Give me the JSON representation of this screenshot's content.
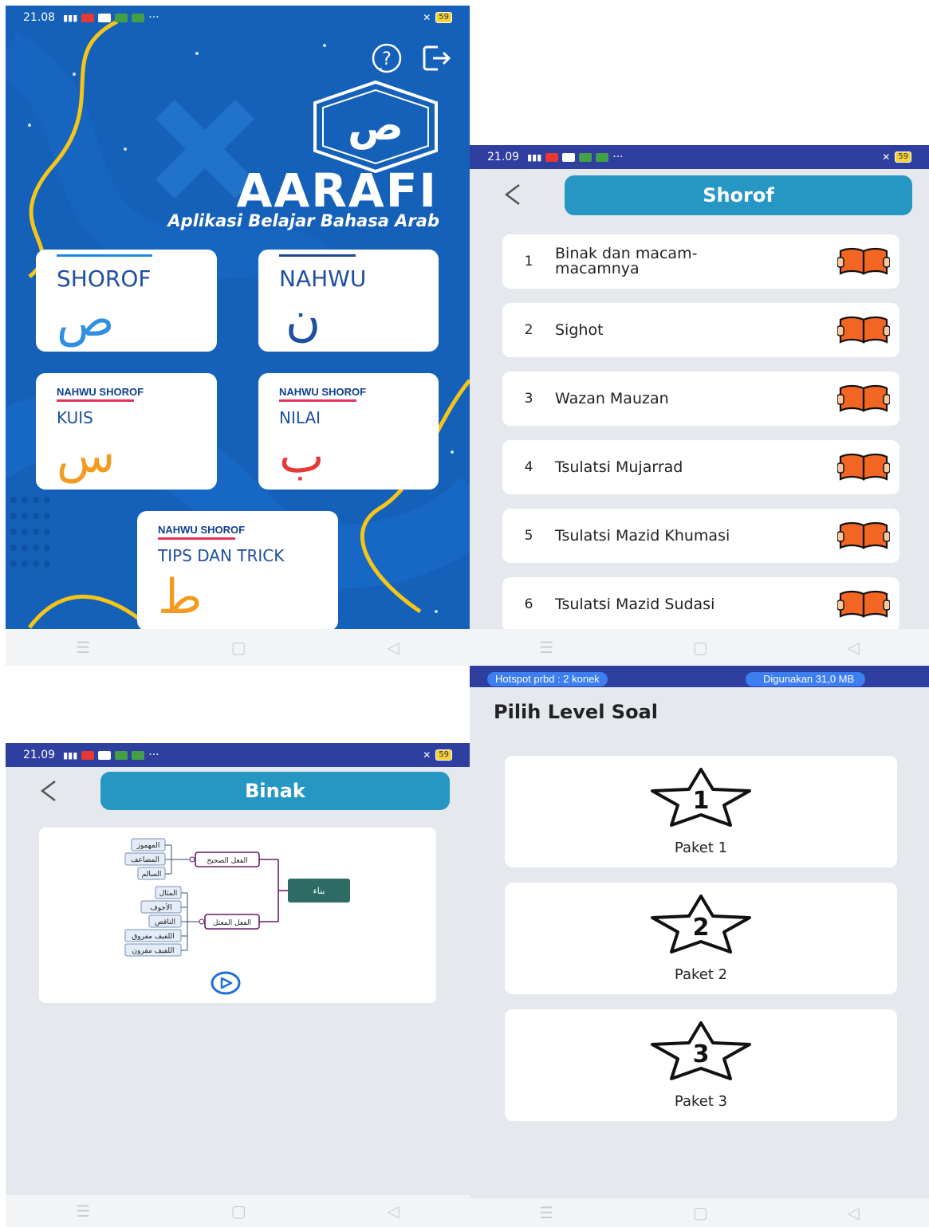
{
  "home": {
    "status_time": "21.08",
    "battery": "59",
    "brand": "AARAFI",
    "tagline": "Aplikasi Belajar Bahasa Arab",
    "help_icon": "help-circle-icon",
    "logout_icon": "logout-icon",
    "cards": {
      "shorof": {
        "title": "SHOROF",
        "letter": "ص"
      },
      "nahwu": {
        "title": "NAHWU",
        "letter": "ن"
      },
      "kuis": {
        "subtitle": "NAHWU SHOROF",
        "title": "KUIS",
        "letter": "س"
      },
      "nilai": {
        "subtitle": "NAHWU SHOROF",
        "title": "NILAI",
        "letter": "ب"
      },
      "tips": {
        "subtitle": "NAHWU SHOROF",
        "title": "TIPS DAN TRICK",
        "letter": "ط"
      }
    },
    "colors": {
      "background": "#1560b8",
      "accent_yellow": "#f5c518",
      "title_blue": "#1f4fa0",
      "underline_red": "#e2325b"
    }
  },
  "shorof": {
    "status_time": "21.09",
    "battery": "59",
    "header": "Shorof",
    "back_icon": "chevron-left-icon",
    "lessons": [
      {
        "num": "1",
        "label": "Binak dan macam-macamnya",
        "icon": "book-icon"
      },
      {
        "num": "2",
        "label": "Sighot",
        "icon": "book-icon"
      },
      {
        "num": "3",
        "label": "Wazan Mauzan",
        "icon": "book-icon"
      },
      {
        "num": "4",
        "label": "Tsulatsi Mujarrad",
        "icon": "book-icon"
      },
      {
        "num": "5",
        "label": "Tsulatsi Mazid Khumasi",
        "icon": "book-icon"
      },
      {
        "num": "6",
        "label": "Tsulatsi Mazid Sudasi",
        "icon": "book-icon"
      }
    ],
    "colors": {
      "header_pill": "#2696c3",
      "book": "#f26522"
    }
  },
  "binak": {
    "status_time": "21.09",
    "battery": "59",
    "header": "Binak",
    "back_icon": "chevron-left-icon",
    "diagram": {
      "root": "بناء",
      "branch_top": "الفعل الصحيح",
      "branch_bottom": "الفعل المعتل",
      "top_leaves": [
        "المهموز",
        "المضاعف",
        "السالم"
      ],
      "bottom_leaves": [
        "المثال",
        "الأجوف",
        "الناقص",
        "اللفيف مفروق",
        "اللفيف مقرون"
      ]
    },
    "play_icon": "play-circle-icon",
    "colors": {
      "root_box": "#2d6b64",
      "branch_border": "#6a1b6a",
      "play": "#1e6fd9"
    }
  },
  "level": {
    "hotspot": "Hotspot prbd : 2 konek",
    "usage": "Digunakan 31,0 MB",
    "title": "Pilih Level Soal",
    "pakets": [
      {
        "number": "1",
        "label": "Paket 1",
        "icon": "star-icon"
      },
      {
        "number": "2",
        "label": "Paket 2",
        "icon": "star-icon"
      },
      {
        "number": "3",
        "label": "Paket 3",
        "icon": "star-icon"
      }
    ]
  }
}
